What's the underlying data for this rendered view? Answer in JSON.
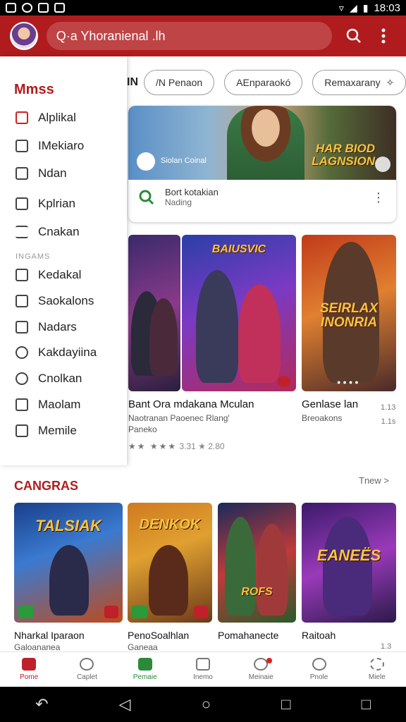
{
  "status_bar": {
    "time": "18:03"
  },
  "app_bar": {
    "search_text": "Q·a Yhoranienal .lh"
  },
  "chips": {
    "prefix": "IN",
    "items": [
      "/N Penaon",
      "AEnparaokó",
      "Remaxarany"
    ]
  },
  "drawer": {
    "title": "Mmss",
    "section_label": "INGAMS",
    "items": [
      {
        "label": "Alplikal",
        "icon": "app-icon"
      },
      {
        "label": "IMekiaro",
        "icon": "tag-icon"
      },
      {
        "label": "Ndan",
        "icon": "calendar-icon"
      },
      {
        "label": "Kplrian",
        "icon": "home-icon"
      },
      {
        "label": "Cnakan",
        "icon": "list-icon"
      },
      {
        "label": "Kedakal",
        "icon": "edit-icon"
      },
      {
        "label": "Saokalons",
        "icon": "gallery-icon"
      },
      {
        "label": "Nadars",
        "icon": "download-icon"
      },
      {
        "label": "Kakdayiina",
        "icon": "heart-icon"
      },
      {
        "label": "Cnolkan",
        "icon": "circle-icon"
      },
      {
        "label": "Maolam",
        "icon": "book-icon"
      },
      {
        "label": "Memile",
        "icon": "card-icon"
      }
    ]
  },
  "featured": {
    "studio": "Siolan Coinal",
    "art_title": "HAR BIOD\nLAGNSION",
    "info_title": "Bort kotakian",
    "info_sub": "Nading"
  },
  "game_row": [
    {
      "title": "Bant Ora mdakana Mculan",
      "sub1": "Naotranan Paoenec Rlang'",
      "sub2": "Paneko",
      "stars_text": "★★  ★★★",
      "rating": "3.31 ★ 2.80"
    },
    {
      "title": "Genlase lan",
      "sub1": "Breoakons",
      "right_num1": "1.13",
      "right_num2": "1.1s"
    }
  ],
  "row_tile_titles": [
    "BAIUSVIC",
    "SEIRLAX INONRIA"
  ],
  "categories": {
    "title": "CANGRAS",
    "more": "Tnew >",
    "cards": [
      {
        "art": "TALSIAK",
        "label": "Nharkal Iparaon",
        "sub": "Galoananea"
      },
      {
        "art": "DENKOK",
        "label": "PenoSoalhlan",
        "sub": "Ganeaa"
      },
      {
        "art": "ROFS",
        "label": "Pomahanecte",
        "sub": ""
      },
      {
        "art": "EANEËS",
        "label": "Raitoah",
        "sub": "",
        "right_num": "1.3"
      }
    ]
  },
  "bottom_nav": [
    {
      "label": "Pome",
      "state": "active-red"
    },
    {
      "label": "Caplet",
      "state": ""
    },
    {
      "label": "Pemaie",
      "state": "active-green"
    },
    {
      "label": "Inemo",
      "state": ""
    },
    {
      "label": "Meinaie",
      "state": "dot"
    },
    {
      "label": "Pnole",
      "state": ""
    },
    {
      "label": "Miele",
      "state": ""
    }
  ],
  "colors": {
    "accent": "#b01c1e",
    "green": "#2a8a3a"
  }
}
